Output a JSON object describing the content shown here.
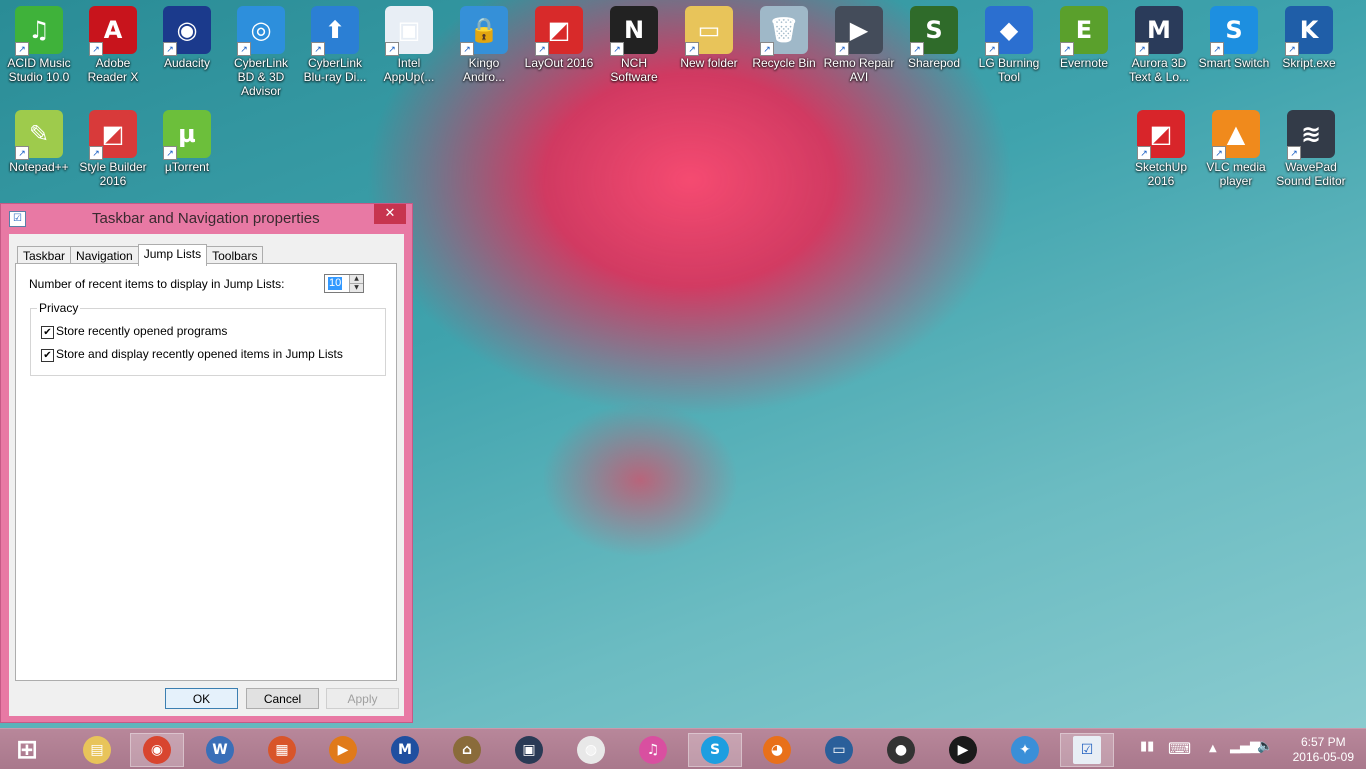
{
  "desktop": {
    "icons": [
      {
        "label": "ACID Music Studio 10.0",
        "glyph": "♫",
        "bg": "#3fb23a",
        "icon": "music-note-icon"
      },
      {
        "label": "Adobe Reader X",
        "glyph": "A",
        "bg": "#c8141c",
        "icon": "pdf-icon"
      },
      {
        "label": "Audacity",
        "glyph": "◉",
        "bg": "#1b3a8c",
        "icon": "headphones-icon"
      },
      {
        "label": "CyberLink BD & 3D Advisor",
        "glyph": "◎",
        "bg": "#2d8fdc",
        "icon": "disc-icon"
      },
      {
        "label": "CyberLink Blu-ray Di...",
        "glyph": "⬆",
        "bg": "#2b7fd4",
        "icon": "upload-arrow-icon"
      },
      {
        "label": "Intel AppUp(...",
        "glyph": "▣",
        "bg": "#e8eef5",
        "icon": "appup-icon"
      },
      {
        "label": "Kingo Andro...",
        "glyph": "🔒",
        "bg": "#3590d8",
        "icon": "lock-icon"
      },
      {
        "label": "LayOut 2016",
        "glyph": "◩",
        "bg": "#d82a2a",
        "icon": "layout-icon"
      },
      {
        "label": "NCH Software",
        "glyph": "N",
        "bg": "#222222",
        "icon": "nch-logo-icon"
      },
      {
        "label": "New folder",
        "glyph": "▭",
        "bg": "#e8c45a",
        "icon": "folder-icon"
      },
      {
        "label": "Recycle Bin",
        "glyph": "🗑",
        "bg": "#9fb8c8",
        "icon": "recycle-bin-icon"
      },
      {
        "label": "Remo Repair AVI",
        "glyph": "▶",
        "bg": "#444c5a",
        "icon": "video-repair-icon"
      },
      {
        "label": "Sharepod",
        "glyph": "S",
        "bg": "#2f6b2a",
        "icon": "sharepod-icon"
      },
      {
        "label": "LG Burning Tool",
        "glyph": "◆",
        "bg": "#2b6fd0",
        "icon": "burning-tool-icon"
      },
      {
        "label": "Evernote",
        "glyph": "E",
        "bg": "#5aa02c",
        "icon": "evernote-icon"
      },
      {
        "label": "Aurora 3D Text & Lo...",
        "glyph": "M",
        "bg": "#2a3b5a",
        "icon": "aurora-3d-icon"
      },
      {
        "label": "Smart Switch",
        "glyph": "S",
        "bg": "#1d8fe0",
        "icon": "smart-switch-icon"
      },
      {
        "label": "Skript.exe",
        "glyph": "K",
        "bg": "#1f5ea8",
        "icon": "skript-icon"
      },
      {
        "label": "Notepad++",
        "glyph": "✎",
        "bg": "#9ecb4c",
        "icon": "notepad-icon"
      },
      {
        "label": "Style Builder 2016",
        "glyph": "◩",
        "bg": "#d83a3a",
        "icon": "style-builder-icon"
      },
      {
        "label": "µTorrent",
        "glyph": "µ",
        "bg": "#6cbf3b",
        "icon": "utorrent-icon"
      },
      {
        "label": "SketchUp 2016",
        "glyph": "◩",
        "bg": "#d8252a",
        "icon": "sketchup-icon"
      },
      {
        "label": "VLC media player",
        "glyph": "▲",
        "bg": "#f08a1c",
        "icon": "vlc-cone-icon"
      },
      {
        "label": "WavePad Sound Editor",
        "glyph": "≋",
        "bg": "#333b48",
        "icon": "waveform-icon"
      }
    ]
  },
  "dialog": {
    "title": "Taskbar and Navigation properties",
    "close": "✕",
    "tabs": [
      "Taskbar",
      "Navigation",
      "Jump Lists",
      "Toolbars"
    ],
    "active_tab": "Jump Lists",
    "recent_items_label": "Number of recent items to display in Jump Lists:",
    "recent_items_value": "10",
    "privacy_group": "Privacy",
    "store_programs": "Store recently opened programs",
    "store_items": "Store and display recently opened items in Jump Lists",
    "ok": "OK",
    "cancel": "Cancel",
    "apply": "Apply"
  },
  "taskbar": {
    "clock_time": "6:57 PM",
    "clock_date": "2016-05-09",
    "apps": [
      {
        "icon": "windows-start-icon",
        "glyph": "⊞",
        "bg": "transparent"
      },
      {
        "icon": "file-explorer-icon",
        "glyph": "▤",
        "bg": "#e8c45a"
      },
      {
        "icon": "chrome-icon",
        "glyph": "◉",
        "bg": "#d8452f"
      },
      {
        "icon": "winzip-icon",
        "glyph": "W",
        "bg": "#3a6fb8"
      },
      {
        "icon": "office-icon",
        "glyph": "▦",
        "bg": "#d8552a"
      },
      {
        "icon": "media-player-icon",
        "glyph": "▶",
        "bg": "#e07a1a"
      },
      {
        "icon": "malwarebytes-icon",
        "glyph": "M",
        "bg": "#1f4fa0"
      },
      {
        "icon": "bank-icon",
        "glyph": "⌂",
        "bg": "#8a6b3a"
      },
      {
        "icon": "video-film-icon",
        "glyph": "▣",
        "bg": "#2a3a55"
      },
      {
        "icon": "weibo-icon",
        "glyph": "◍",
        "bg": "#e8e8e8"
      },
      {
        "icon": "itunes-icon",
        "glyph": "♫",
        "bg": "#d94fa0"
      },
      {
        "icon": "skype-icon",
        "glyph": "S",
        "bg": "#1d9ee0"
      },
      {
        "icon": "firefox-icon",
        "glyph": "◕",
        "bg": "#e8701a"
      },
      {
        "icon": "remote-desktop-icon",
        "glyph": "▭",
        "bg": "#2a5f9a"
      },
      {
        "icon": "hypercam-icon",
        "glyph": "●",
        "bg": "#333333"
      },
      {
        "icon": "play-circle-icon",
        "glyph": "▶",
        "bg": "#1a1a1a"
      },
      {
        "icon": "safari-icon",
        "glyph": "✦",
        "bg": "#3a8fd8"
      },
      {
        "icon": "taskbar-properties-icon",
        "glyph": "☑",
        "bg": "#e8eef5"
      }
    ]
  }
}
